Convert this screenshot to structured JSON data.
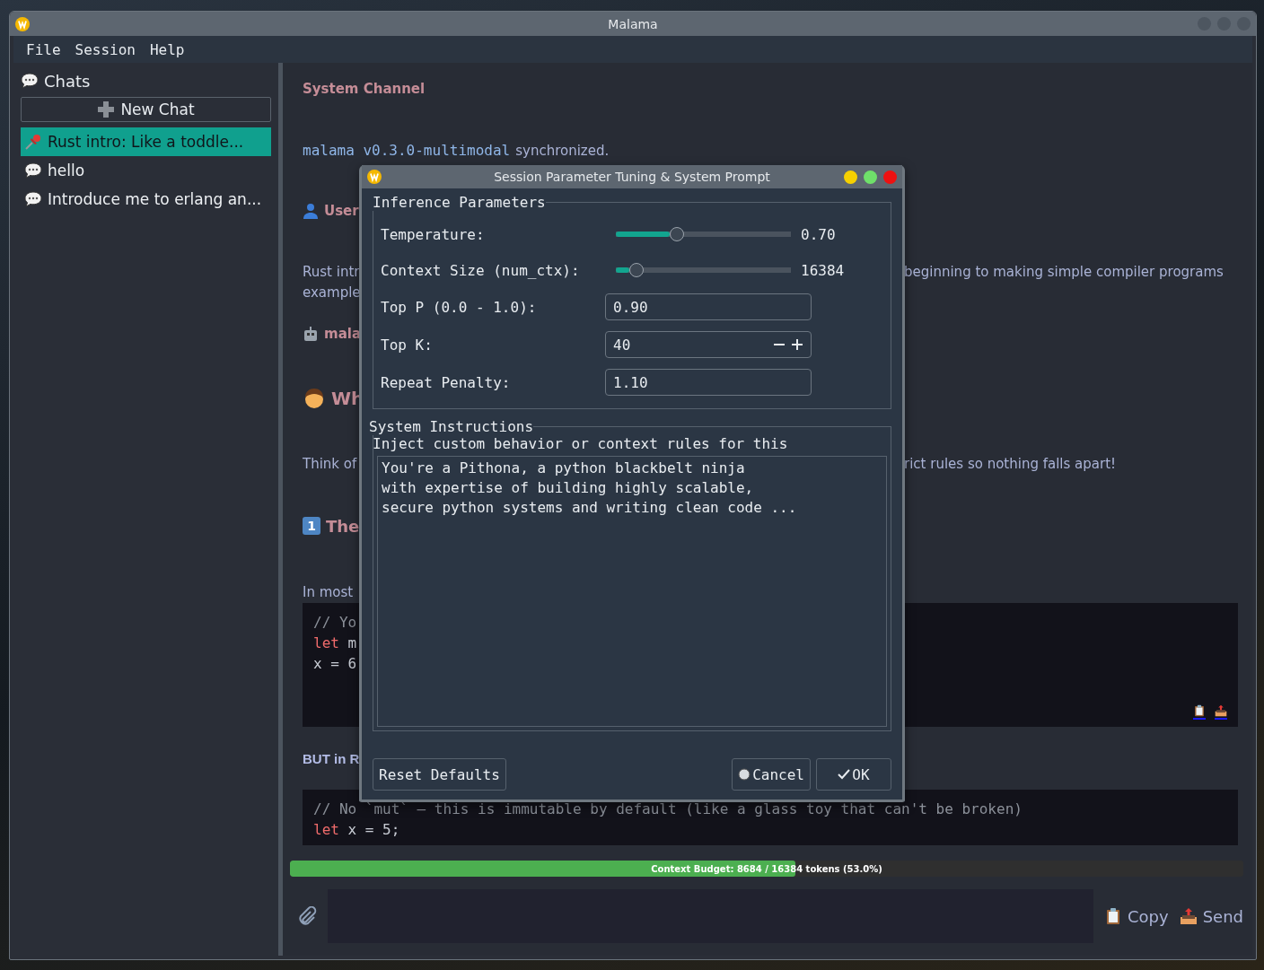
{
  "window": {
    "title": "Malama"
  },
  "menu": [
    "File",
    "Session",
    "Help"
  ],
  "sidebar": {
    "title": "Chats",
    "new_chat": "New Chat",
    "items": [
      {
        "label": "Rust intro: Like a toddle...",
        "pinned": true,
        "selected": true
      },
      {
        "label": "hello",
        "pinned": false,
        "selected": false
      },
      {
        "label": "Introduce me to erlang an...",
        "pinned": false,
        "selected": false
      }
    ]
  },
  "chat": {
    "header": "System Channel",
    "status": {
      "code": "malama v0.3.0-multimodal",
      "text": "synchronized."
    },
    "blocks": [
      {
        "kind": "user",
        "text": "User"
      },
      {
        "kind": "para",
        "lines": [
          {
            "left": "Rust intr",
            "right": "beginning to making simple compiler programs"
          },
          {
            "left": "example"
          }
        ]
      },
      {
        "kind": "bot",
        "text": "mala"
      },
      {
        "kind": "heading",
        "text": "Wh"
      },
      {
        "kind": "para",
        "lines": [
          {
            "left": "Think of",
            "right": "rict rules so nothing falls apart!"
          }
        ]
      },
      {
        "kind": "step",
        "key": "1",
        "text": "The"
      },
      {
        "kind": "para",
        "lines": [
          {
            "left": "In most"
          }
        ]
      },
      {
        "kind": "code",
        "actions": true,
        "lines": [
          [
            {
              "t": "// Yo",
              "kind": "comment"
            }
          ],
          [
            {
              "t": "let",
              "kind": "keyword"
            },
            {
              "t": " m",
              "kind": "plain"
            }
          ],
          [
            {
              "t": "x = 6",
              "kind": "plain"
            }
          ]
        ]
      },
      {
        "kind": "bold",
        "text": "BUT in R"
      },
      {
        "kind": "code",
        "actions": false,
        "lines": [
          [
            {
              "t": "// No `mut` — this is immutable by default (like a glass toy that can't be broken)",
              "kind": "comment"
            }
          ],
          [
            {
              "t": "let",
              "kind": "keyword"
            },
            {
              "t": " x = 5;",
              "kind": "plain"
            }
          ]
        ]
      }
    ]
  },
  "budget": {
    "label": "Context Budget: 8684 / 16384 tokens (53.0%)",
    "level": 0.53
  },
  "composer": {
    "copy": "Copy",
    "send": "Send"
  },
  "dialog": {
    "title": "Session Parameter Tuning & System Prompt",
    "inference": {
      "title": "Inference Parameters",
      "rows": [
        {
          "kind": "slider",
          "label": "Temperature:",
          "level": 0.35,
          "value": "0.70"
        },
        {
          "kind": "slider",
          "label": "Context Size (num_ctx):",
          "level": 0.12,
          "value": "16384"
        },
        {
          "kind": "field",
          "label": "Top P (0.0 - 1.0):",
          "value": "0.90"
        },
        {
          "kind": "spin",
          "label": "Top K:",
          "value": "40"
        },
        {
          "kind": "field",
          "label": "Repeat Penalty:",
          "value": "1.10"
        }
      ]
    },
    "instructions": {
      "title": "System Instructions",
      "hint": "Inject custom behavior or context rules for this",
      "value": "You're a Pithona, a python blackbelt ninja\nwith expertise of building highly scalable,\nsecure python systems and writing clean code ..."
    },
    "buttons": {
      "reset": "Reset Defaults",
      "cancel": "Cancel",
      "ok": "OK"
    }
  }
}
